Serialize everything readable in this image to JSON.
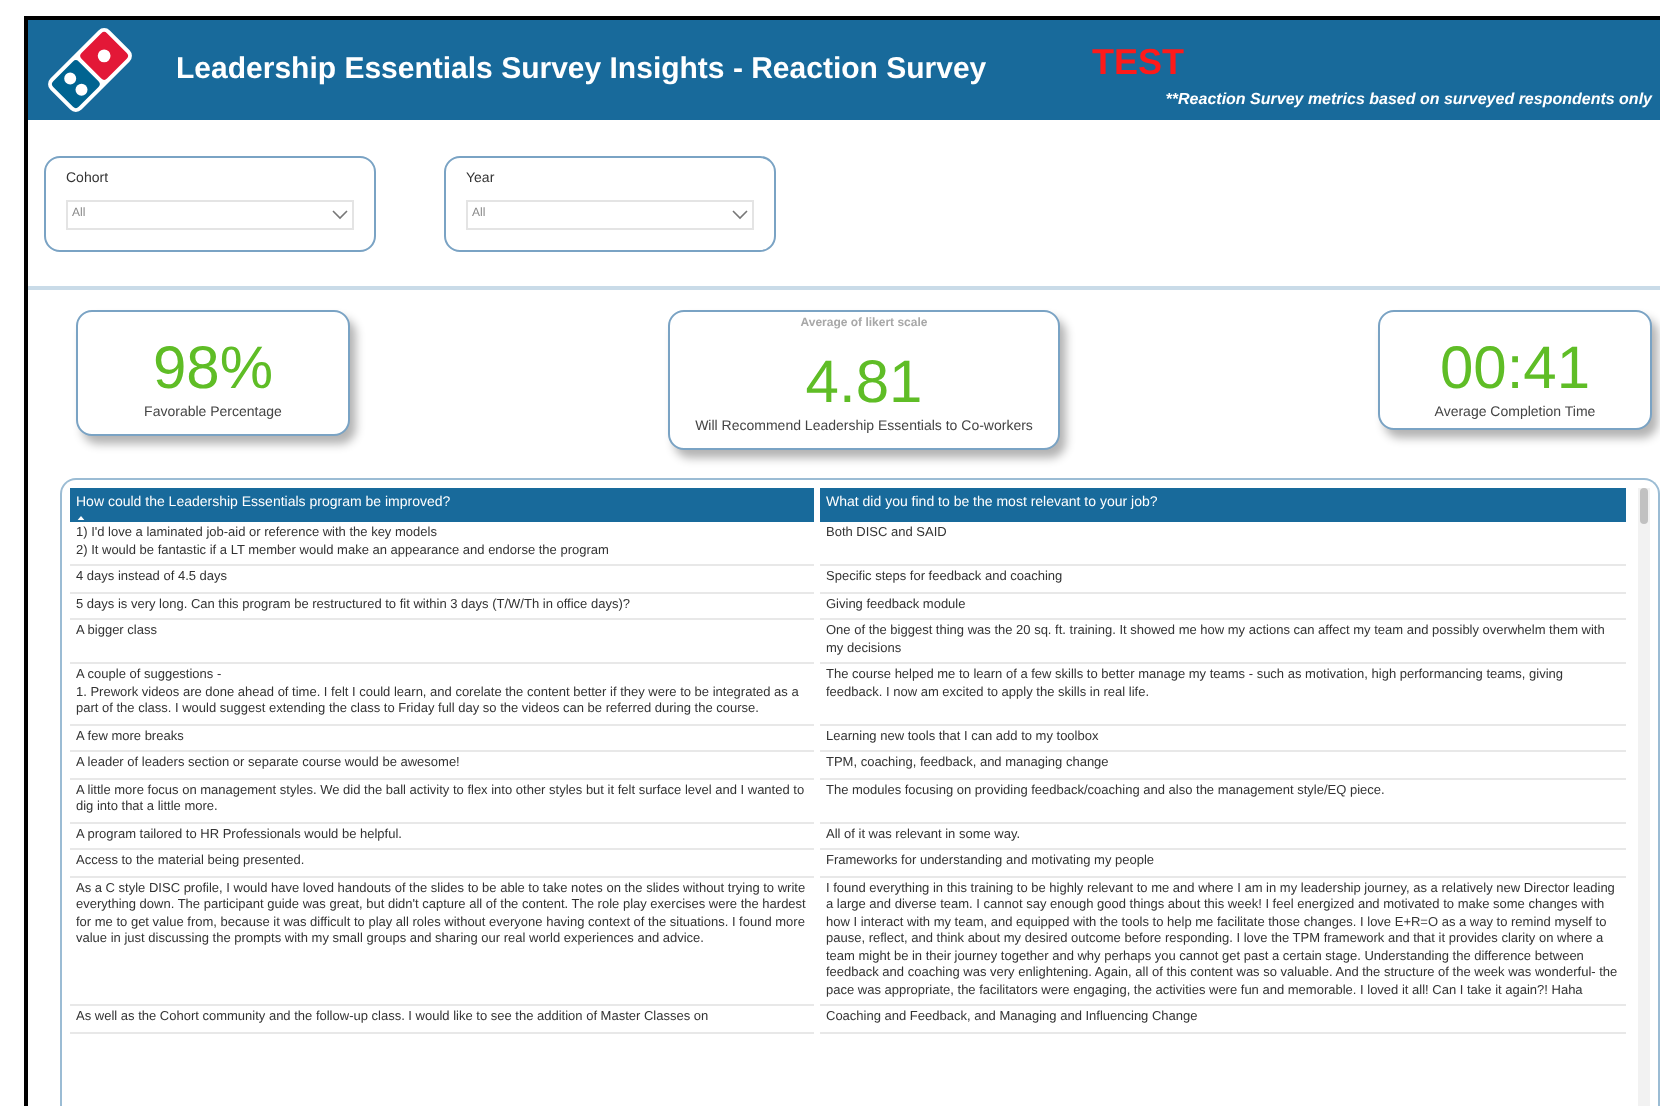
{
  "header": {
    "title": "Leadership Essentials Survey Insights - Reaction Survey",
    "tag": "TEST",
    "note": "**Reaction Survey metrics based on surveyed respondents only"
  },
  "filters": [
    {
      "label": "Cohort",
      "value": "All"
    },
    {
      "label": "Year",
      "value": "All"
    }
  ],
  "kpis": [
    {
      "value": "98%",
      "label": "Favorable Percentage"
    },
    {
      "title": "Average of likert scale",
      "value": "4.81",
      "label": "Will Recommend Leadership Essentials to Co-workers"
    },
    {
      "value": "00:41",
      "label": "Average Completion Time"
    }
  ],
  "table": {
    "columns": [
      "How could the Leadership Essentials program be improved?",
      "What did you find to be the most relevant to your job?"
    ],
    "rows": [
      [
        "1) I'd love a laminated job-aid or reference with the key models\n2) It would be fantastic if a LT member would make an appearance and endorse the program",
        "Both DISC and SAID"
      ],
      [
        "4 days instead of 4.5 days",
        "Specific steps for feedback and coaching"
      ],
      [
        "5 days is very long. Can this program be restructured to fit within 3 days (T/W/Th in office days)?",
        "Giving feedback module"
      ],
      [
        "A bigger class",
        "One of the biggest thing was the 20 sq. ft. training. It showed me how my actions can affect my team and possibly overwhelm them with my decisions"
      ],
      [
        "A couple of suggestions -\n1. Prework videos are done ahead of time. I felt I could learn, and corelate the content better if they were to be integrated as a part of the class. I would suggest extending the class to Friday full day so the videos can be referred during the course.",
        "The course helped me to learn of a few skills to better manage my teams - such as motivation, high performancing teams, giving feedback. I now am excited to apply the skills in real life."
      ],
      [
        "A few more breaks",
        "Learning new tools that I can add to my toolbox"
      ],
      [
        "A leader of leaders section or separate course would be awesome!",
        "TPM, coaching, feedback, and managing change"
      ],
      [
        "A little more focus on management styles. We did the ball activity to flex into other styles but it felt surface level and I wanted to dig into that a little more.",
        "The modules focusing on providing feedback/coaching and also the management style/EQ piece."
      ],
      [
        "A program tailored to HR Professionals would be helpful.",
        "All of it was relevant in some way."
      ],
      [
        "Access to the material being presented.",
        "Frameworks for understanding and motivating my people"
      ],
      [
        "As a C style DISC profile, I would have loved handouts of the slides to be able to take notes on the slides without trying to write everything down. The participant guide was great, but didn't capture all of the content. The role play exercises were the hardest for me to get value from, because it was difficult to play all roles without everyone having context of the situations. I found more value in just discussing the prompts with my small groups and sharing our real world experiences and advice.",
        "I found everything in this training to be highly relevant to me and where I am in my leadership journey, as a relatively new Director leading a large and diverse team. I cannot say enough good things about this week! I feel energized and motivated to make some changes with how I interact with my team, and equipped with the tools to help me facilitate those changes. I love E+R=O as a way to remind myself to pause, reflect, and think about my desired outcome before responding. I love the TPM framework and that it provides clarity on where a team might be in their journey together and why perhaps you cannot get past a certain stage. Understanding the difference between feedback and coaching was very enlightening. Again, all of this content was so valuable. And the structure of the week was wonderful- the pace was appropriate, the facilitators were engaging, the activities were fun and memorable. I loved it all! Can I take it again?! Haha"
      ],
      [
        "As well as the Cohort community and the follow-up class. I would like to see the addition of Master Classes on",
        "Coaching and Feedback, and Managing and Influencing Change"
      ]
    ]
  }
}
